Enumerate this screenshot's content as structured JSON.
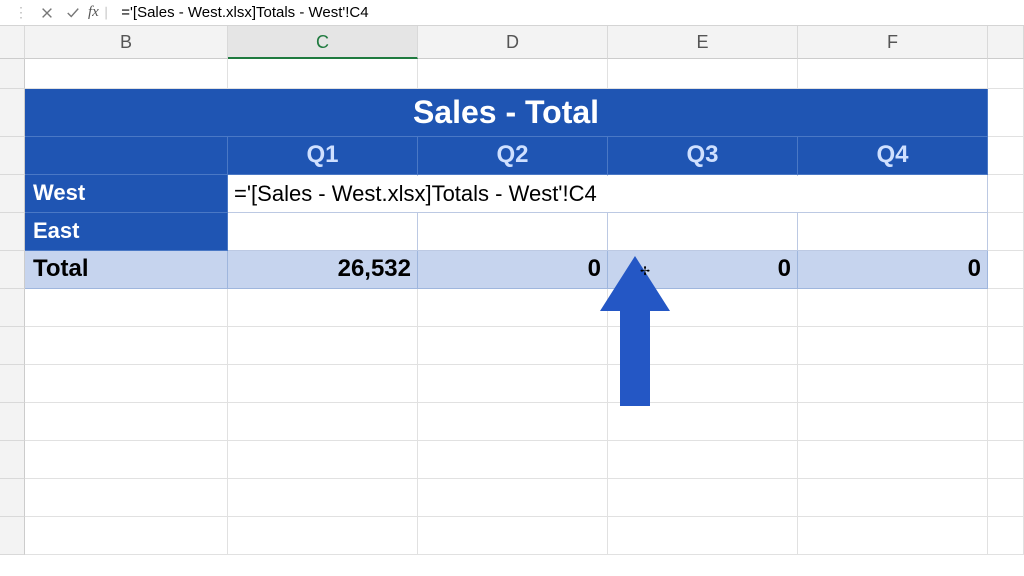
{
  "formula_bar": {
    "fx_label": "fx",
    "value": "='[Sales - West.xlsx]Totals - West'!C4"
  },
  "columns": [
    "B",
    "C",
    "D",
    "E",
    "F"
  ],
  "selected_column": "C",
  "table": {
    "title": "Sales - Total",
    "quarters": [
      "Q1",
      "Q2",
      "Q3",
      "Q4"
    ],
    "rows": [
      {
        "label": "West"
      },
      {
        "label": "East"
      }
    ],
    "total_label": "Total",
    "totals": [
      "26,532",
      "0",
      "0",
      "0"
    ]
  },
  "editing_text": "='[Sales - West.xlsx]Totals - West'!C4"
}
